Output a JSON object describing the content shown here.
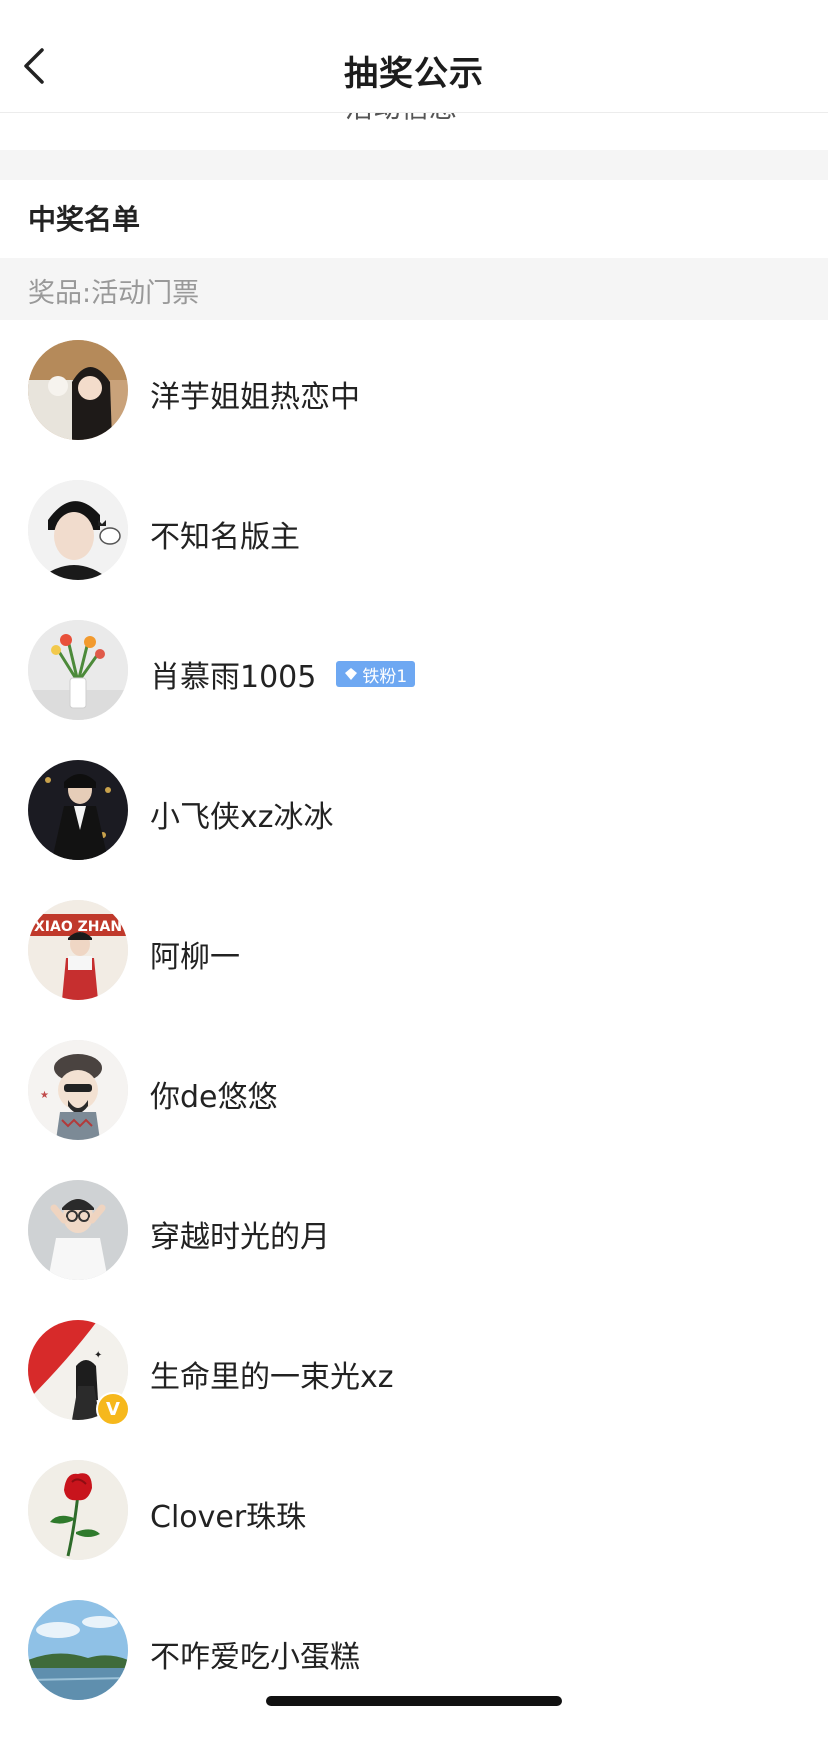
{
  "nav": {
    "title": "抽奖公示",
    "back_icon": "back-chevron-icon"
  },
  "activity_info": {
    "label": "活动信息",
    "icon": "chevron-down-icon"
  },
  "section": {
    "title": "中奖名单"
  },
  "prize": {
    "label": "奖品:活动门票"
  },
  "winners": [
    {
      "name": "洋芋姐姐热恋中"
    },
    {
      "name": "不知名版主"
    },
    {
      "name": "肖慕雨1005",
      "badge": "铁粉1"
    },
    {
      "name": "小飞侠xz冰冰"
    },
    {
      "name": "阿柳一"
    },
    {
      "name": "你de悠悠"
    },
    {
      "name": "穿越时光的月"
    },
    {
      "name": "生命里的一束光xz",
      "verified": "V"
    },
    {
      "name": "Clover珠珠"
    },
    {
      "name": "不咋爱吃小蛋糕"
    }
  ],
  "colors": {
    "badge": "#6ea8f2",
    "verified": "#f6b81c",
    "band": "#f5f5f5"
  }
}
